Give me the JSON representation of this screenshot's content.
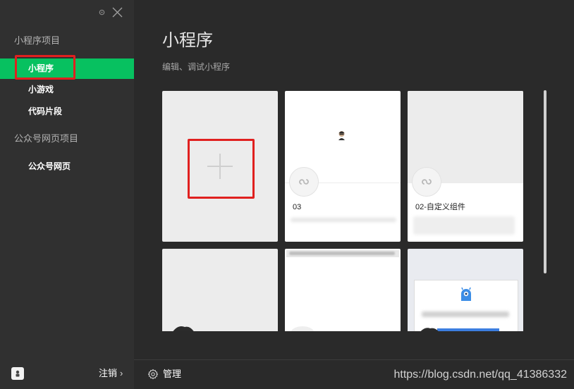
{
  "window": {
    "settings_icon": "gear-icon",
    "close_icon": "close-icon"
  },
  "sidebar": {
    "group_miniprogram": "小程序项目",
    "items": [
      {
        "label": "小程序"
      },
      {
        "label": "小游戏"
      },
      {
        "label": "代码片段"
      }
    ],
    "selected_index": 0,
    "group_web": "公众号网页项目",
    "web_items": [
      {
        "label": "公众号网页"
      }
    ],
    "user_icon": "user-avatar-icon",
    "logout_label": "注销",
    "logout_arrow": "›"
  },
  "main": {
    "title": "小程序",
    "subtitle": "编辑、调试小程序"
  },
  "projects": [
    {
      "icon": "plus-icon"
    },
    {
      "name": "03",
      "icon": "miniprogram-logo-icon"
    },
    {
      "name": "02-自定义组件",
      "icon": "miniprogram-logo-icon"
    }
  ],
  "footer": {
    "manage_icon": "gear-icon",
    "manage_label": "管理"
  },
  "watermark": "https://blog.csdn.net/qq_41386332",
  "colors": {
    "accent": "#07c160",
    "annotation": "#e0201f",
    "sidebar_bg": "#303030",
    "main_bg": "#2a2a2a"
  }
}
